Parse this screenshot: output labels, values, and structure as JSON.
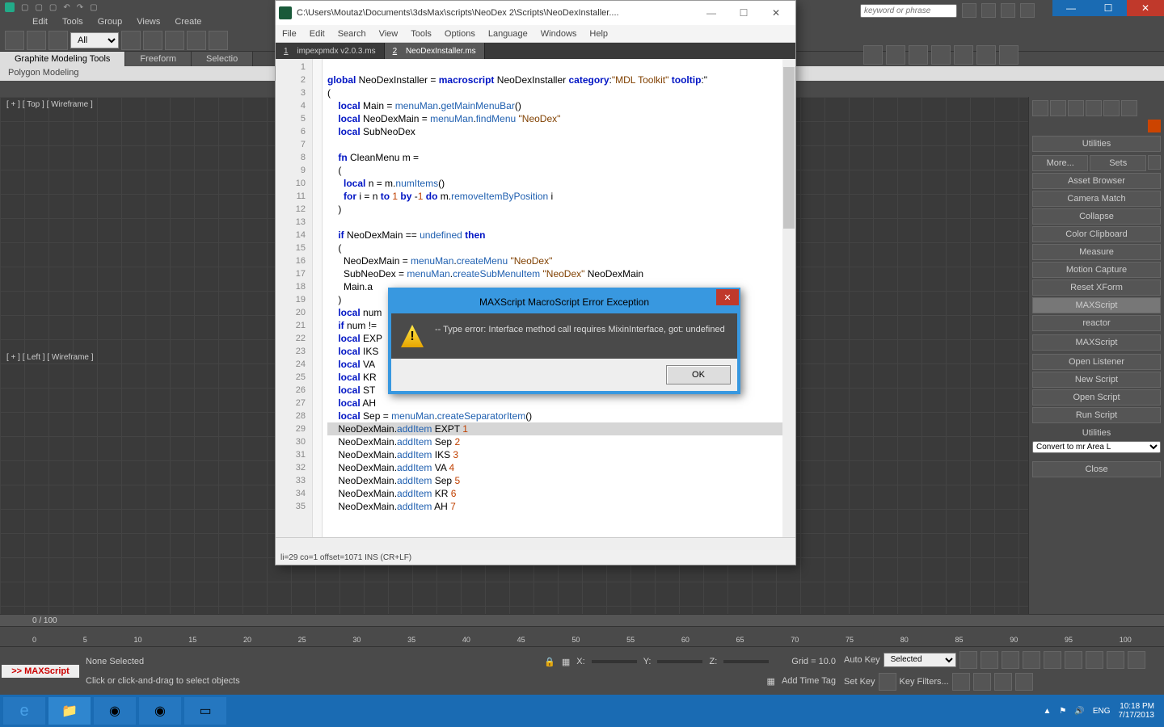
{
  "app": {
    "main_menu": [
      "Edit",
      "Tools",
      "Group",
      "Views",
      "Create"
    ],
    "search_placeholder": "keyword or phrase"
  },
  "ribbon": {
    "tabs": [
      "Graphite Modeling Tools",
      "Freeform",
      "Selectio"
    ],
    "sub": "Polygon Modeling"
  },
  "viewport": {
    "top_label": "[ + ] [ Top ] [ Wireframe ]",
    "left_label": "[ + ] [ Left ] [ Wireframe ]"
  },
  "command_panel": {
    "utilities_header": "Utilities",
    "more": "More...",
    "sets": "Sets",
    "buttons": [
      "Asset Browser",
      "Camera Match",
      "Collapse",
      "Color Clipboard",
      "Measure",
      "Motion Capture",
      "Reset XForm",
      "MAXScript",
      "reactor"
    ],
    "mxs_header": "MAXScript",
    "mxs_buttons": [
      "Open Listener",
      "New Script",
      "Open Script",
      "Run Script"
    ],
    "section_label": "Utilities",
    "select_value": "Convert to mr Area L",
    "close": "Close"
  },
  "timeline": {
    "frame": "0 / 100",
    "ticks": [
      "0",
      "5",
      "10",
      "15",
      "20",
      "25",
      "30",
      "35",
      "40",
      "45",
      "50",
      "55",
      "60",
      "65",
      "70",
      "75",
      "80",
      "85",
      "90",
      "95",
      "100"
    ]
  },
  "status": {
    "selection": "None Selected",
    "prompt": "Click or click-and-drag to select objects",
    "maxscript": ">> MAXScript",
    "x": "X:",
    "y": "Y:",
    "z": "Z:",
    "grid": "Grid = 10.0",
    "add_time_tag": "Add Time Tag",
    "auto_key": "Auto Key",
    "set_key": "Set Key",
    "selected": "Selected",
    "key_filters": "Key Filters..."
  },
  "taskbar": {
    "tray": {
      "ime": "ENG",
      "time": "10:18 PM",
      "date": "7/17/2013"
    }
  },
  "script_window": {
    "title": "C:\\Users\\Moutaz\\Documents\\3dsMax\\scripts\\NeoDex 2\\Scripts\\NeoDexInstaller....",
    "menu": [
      "File",
      "Edit",
      "Search",
      "View",
      "Tools",
      "Options",
      "Language",
      "Windows",
      "Help"
    ],
    "tabs": [
      {
        "n": "1",
        "name": "impexpmdx v2.0.3.ms"
      },
      {
        "n": "2",
        "name": "NeoDexInstaller.ms"
      }
    ],
    "status": "li=29 co=1 offset=1071 INS (CR+LF)",
    "code": {
      "lines": [
        {
          "n": 1,
          "raw": ""
        },
        {
          "n": 2,
          "raw": "global NeoDexInstaller = macroscript NeoDexInstaller category:\"MDL Toolkit\" tooltip:\""
        },
        {
          "n": 3,
          "raw": "("
        },
        {
          "n": 4,
          "raw": "    local Main = menuMan.getMainMenuBar()"
        },
        {
          "n": 5,
          "raw": "    local NeoDexMain = menuMan.findMenu \"NeoDex\""
        },
        {
          "n": 6,
          "raw": "    local SubNeoDex"
        },
        {
          "n": 7,
          "raw": ""
        },
        {
          "n": 8,
          "raw": "    fn CleanMenu m ="
        },
        {
          "n": 9,
          "raw": "    ("
        },
        {
          "n": 10,
          "raw": "      local n = m.numItems()"
        },
        {
          "n": 11,
          "raw": "      for i = n to 1 by -1 do m.removeItemByPosition i"
        },
        {
          "n": 12,
          "raw": "    )"
        },
        {
          "n": 13,
          "raw": ""
        },
        {
          "n": 14,
          "raw": "    if NeoDexMain == undefined then"
        },
        {
          "n": 15,
          "raw": "    ("
        },
        {
          "n": 16,
          "raw": "      NeoDexMain = menuMan.createMenu \"NeoDex\""
        },
        {
          "n": 17,
          "raw": "      SubNeoDex = menuMan.createSubMenuItem \"NeoDex\" NeoDexMain"
        },
        {
          "n": 18,
          "raw": "      Main.a"
        },
        {
          "n": 19,
          "raw": "    )"
        },
        {
          "n": 20,
          "raw": "    local num"
        },
        {
          "n": 21,
          "raw": "    if num !="
        },
        {
          "n": 22,
          "raw": "    local EXP                                                                                    ort\""
        },
        {
          "n": 23,
          "raw": "    local IKS"
        },
        {
          "n": 24,
          "raw": "    local VA                                                                                     rs\""
        },
        {
          "n": 25,
          "raw": "    local KR"
        },
        {
          "n": 26,
          "raw": "    local ST"
        },
        {
          "n": 27,
          "raw": "    local AH"
        },
        {
          "n": 28,
          "raw": "    local Sep = menuMan.createSeparatorItem()"
        },
        {
          "n": 29,
          "raw": "    NeoDexMain.addItem EXPT 1",
          "hl": true
        },
        {
          "n": 30,
          "raw": "    NeoDexMain.addItem Sep 2"
        },
        {
          "n": 31,
          "raw": "    NeoDexMain.addItem IKS 3"
        },
        {
          "n": 32,
          "raw": "    NeoDexMain.addItem VA 4"
        },
        {
          "n": 33,
          "raw": "    NeoDexMain.addItem Sep 5"
        },
        {
          "n": 34,
          "raw": "    NeoDexMain.addItem KR 6"
        },
        {
          "n": 35,
          "raw": "    NeoDexMain.addItem AH 7"
        }
      ]
    }
  },
  "error_dialog": {
    "title": "MAXScript MacroScript Error Exception",
    "message": "-- Type error: Interface method call requires MixinInterface, got: undefined",
    "ok": "OK"
  },
  "toolbar_dropdown": "All"
}
